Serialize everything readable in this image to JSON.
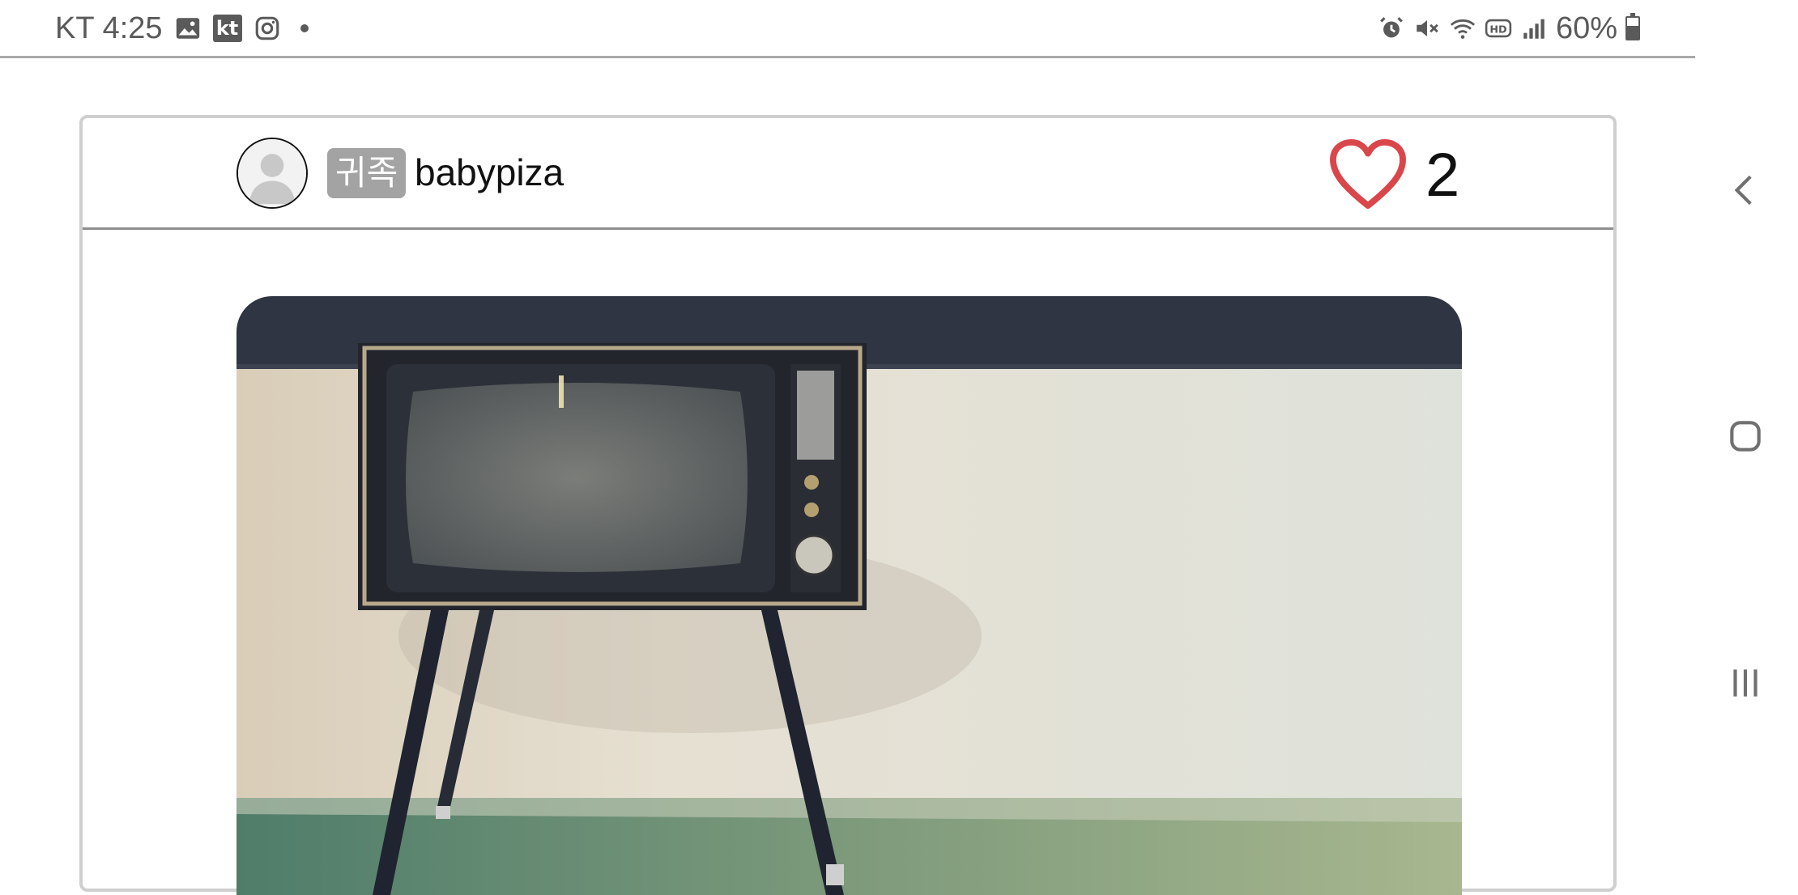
{
  "status_bar": {
    "carrier": "KT",
    "time": "4:25",
    "battery": "60%",
    "left_icons": [
      "gallery-icon",
      "kt-app-icon",
      "instagram-icon",
      "notification-dot"
    ],
    "right_icons": [
      "alarm-icon",
      "mute-icon",
      "wifi-icon",
      "hd-icon",
      "signal-icon",
      "battery-icon"
    ],
    "kt_label": "kt"
  },
  "post": {
    "rank_badge": "귀족",
    "username": "babypiza",
    "like_count": "2",
    "like_color": "#d9474b",
    "image_subject": "vintage-tv-on-legs-against-wall"
  },
  "nav_bar": {
    "buttons": [
      "back-icon",
      "home-icon",
      "recents-icon"
    ]
  }
}
